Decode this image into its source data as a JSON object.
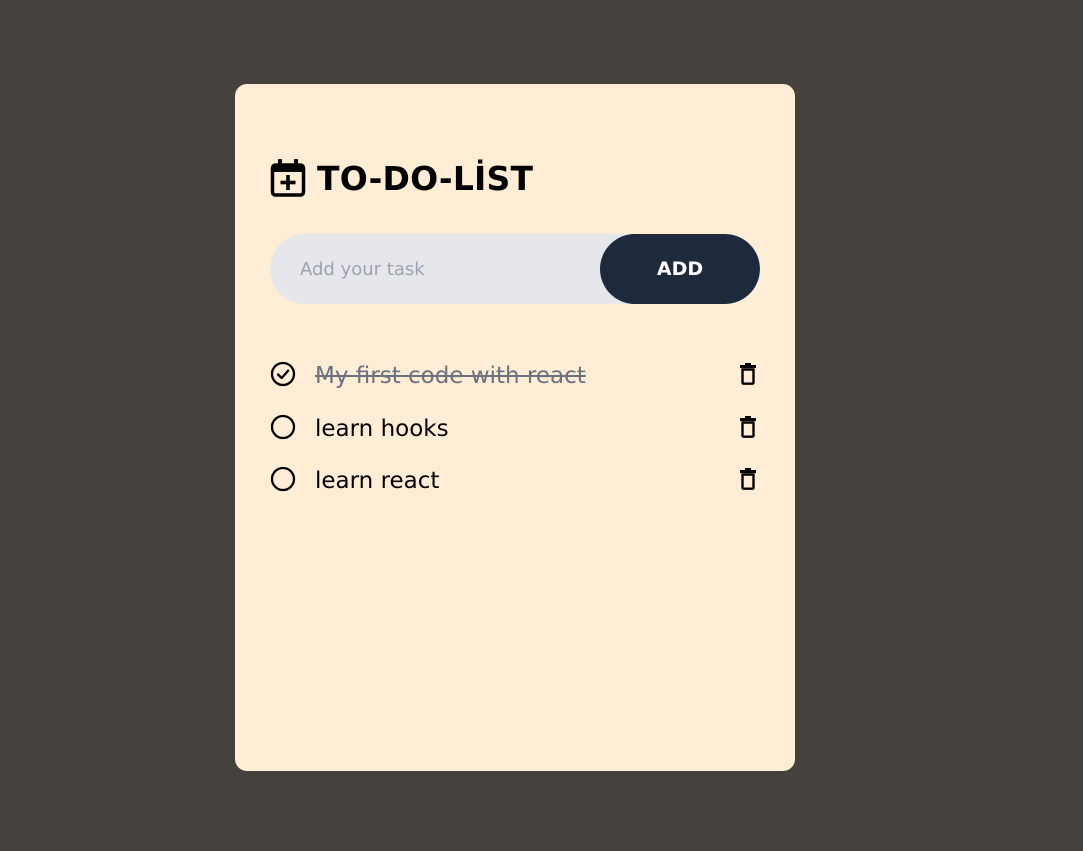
{
  "app": {
    "title": "TO-DO-LİST",
    "title_icon": "calendar-plus-icon"
  },
  "input": {
    "placeholder": "Add your task",
    "value": "",
    "add_label": "ADD"
  },
  "colors": {
    "background": "#45413c",
    "card": "#ffedd5",
    "input_bg": "#e5e7eb",
    "button_bg": "#1e293b",
    "done_text": "#6b7280"
  },
  "tasks": [
    {
      "text": "My first code with react",
      "done": true,
      "status_icon": "checked-circle-icon",
      "delete_icon": "trash-icon"
    },
    {
      "text": "learn hooks",
      "done": false,
      "status_icon": "empty-circle-icon",
      "delete_icon": "trash-icon"
    },
    {
      "text": "learn react",
      "done": false,
      "status_icon": "empty-circle-icon",
      "delete_icon": "trash-icon"
    }
  ]
}
